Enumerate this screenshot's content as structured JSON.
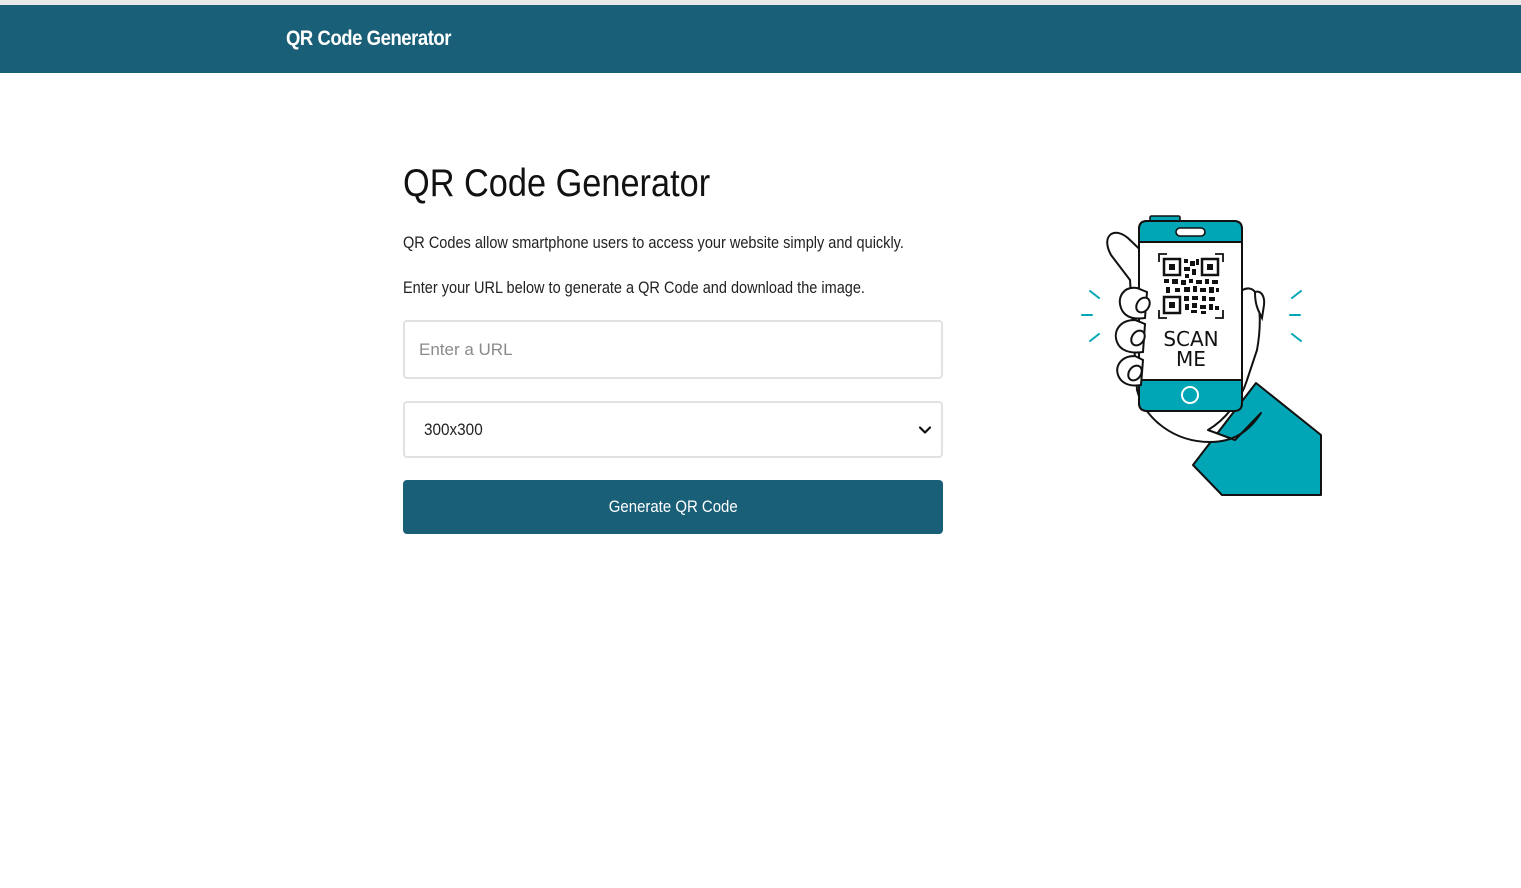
{
  "navbar": {
    "brand": "QR Code Generator"
  },
  "main": {
    "title": "QR Code Generator",
    "description_1": "QR Codes allow smartphone users to access your website simply and quickly.",
    "description_2": "Enter your URL below to generate a QR Code and download the image.",
    "url_input": {
      "placeholder": "Enter a URL",
      "value": ""
    },
    "size_select": {
      "selected": "300x300"
    },
    "generate_button": "Generate QR Code"
  },
  "illustration": {
    "scan_text_1": "SCAN",
    "scan_text_2": "ME"
  },
  "colors": {
    "brand": "#195f77",
    "accent": "#00a6b5"
  }
}
